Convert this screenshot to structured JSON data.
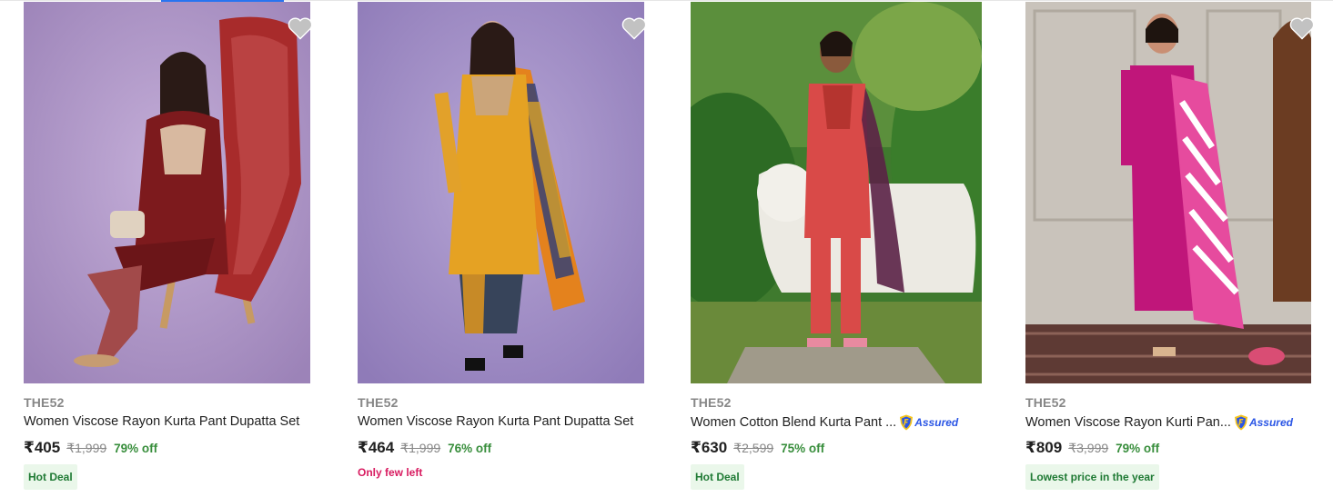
{
  "products": [
    {
      "brand": "THE52",
      "title": "Women Viscose Rayon Kurta Pant Dupatta Set",
      "assured": "",
      "price": "₹405",
      "mrp": "₹1,999",
      "off": "79% off",
      "badge": "Hot Deal",
      "few": ""
    },
    {
      "brand": "THE52",
      "title": "Women Viscose Rayon Kurta Pant Dupatta Set",
      "assured": "",
      "price": "₹464",
      "mrp": "₹1,999",
      "off": "76% off",
      "badge": "",
      "few": "Only few left"
    },
    {
      "brand": "THE52",
      "title": "Women Cotton Blend Kurta Pant ...",
      "assured": "Assured",
      "price": "₹630",
      "mrp": "₹2,599",
      "off": "75% off",
      "badge": "Hot Deal",
      "few": ""
    },
    {
      "brand": "THE52",
      "title": "Women Viscose Rayon Kurti Pan...",
      "assured": "Assured",
      "price": "₹809",
      "mrp": "₹3,999",
      "off": "79% off",
      "badge": "Lowest price in the year",
      "few": ""
    }
  ],
  "icons": {
    "wishlist": "heart-icon",
    "assured": "assured-shield-icon"
  },
  "colors": {
    "price_off": "#388e3c",
    "badge_bg": "#eaf7ea",
    "few_left": "#d81b60",
    "assured": "#2a55e5"
  }
}
